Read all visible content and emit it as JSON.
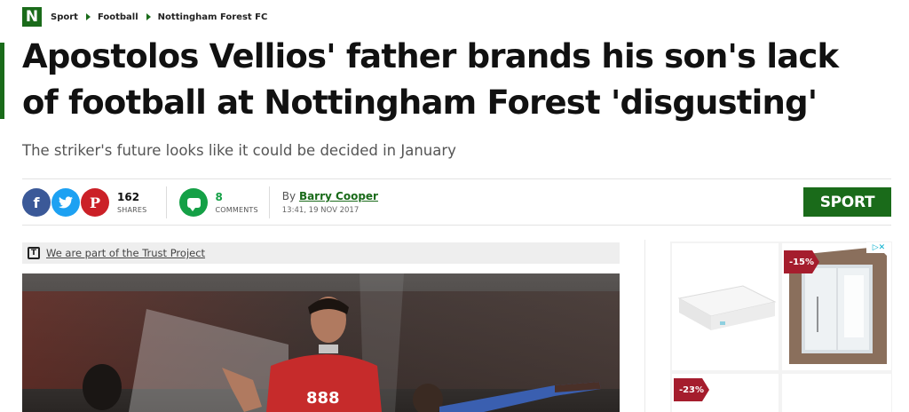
{
  "breadcrumb": {
    "logo": "N",
    "items": [
      "Sport",
      "Football",
      "Nottingham Forest FC"
    ]
  },
  "headline": "Apostolos Vellios' father brands his son's lack of football at Nottingham Forest 'disgusting'",
  "subheadline": "The striker's future looks like it could be decided in January",
  "share": {
    "facebook_icon": "f",
    "twitter_icon": "twitter-bird",
    "pinterest_icon": "P",
    "shares_count": "162",
    "shares_label": "SHARES",
    "comments_count": "8",
    "comments_label": "COMMENTS"
  },
  "byline": {
    "prefix": "By",
    "author": "Barry Cooper",
    "timestamp": "13:41, 19 NOV 2017"
  },
  "section_badge": "SPORT",
  "trust": {
    "icon": "T",
    "text": "We are part of the Trust Project"
  },
  "ad": {
    "adchoices": "▷✕",
    "discounts": [
      "-15%",
      "-23%"
    ]
  },
  "colors": {
    "brand_green": "#1a6b1a",
    "comment_green": "#14a046",
    "facebook": "#3b5998",
    "twitter": "#1da1f2",
    "pinterest": "#cb2027",
    "discount_tag": "#a51d2d"
  }
}
